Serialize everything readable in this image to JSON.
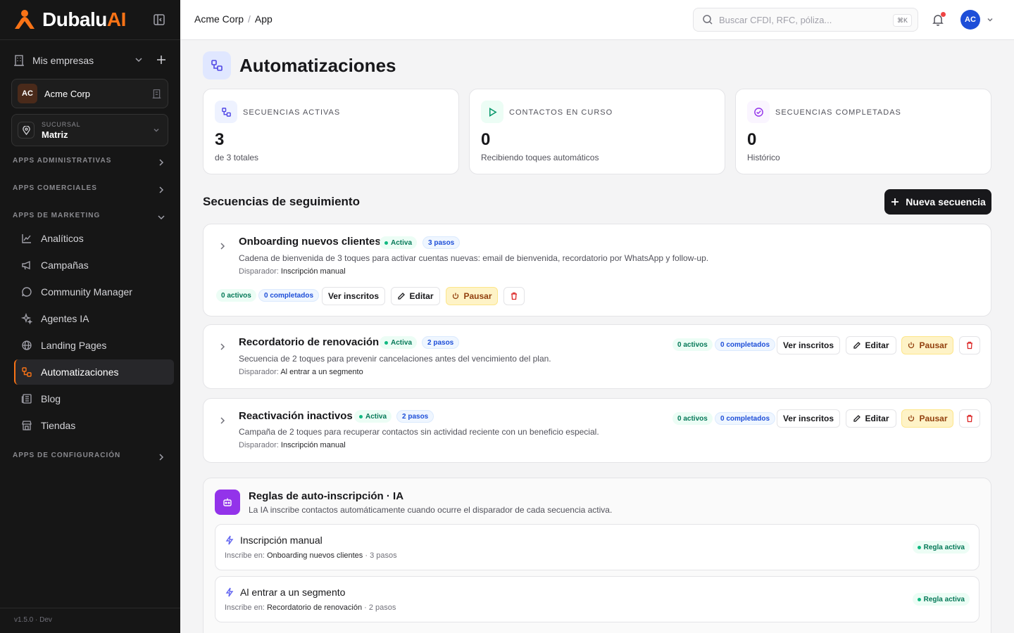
{
  "brand": {
    "name_main": "Dubalu",
    "name_accent": "AI"
  },
  "sidebar": {
    "mis_empresas": "Mis empresas",
    "company": {
      "initials": "AC",
      "name": "Acme Corp"
    },
    "branch": {
      "label": "SUCURSAL",
      "value": "Matriz"
    },
    "sections": {
      "admin": "APPS ADMINISTRATIVAS",
      "comercial": "APPS COMERCIALES",
      "marketing": "APPS DE MARKETING",
      "config": "APPS DE CONFIGURACIÓN"
    },
    "items": [
      {
        "label": "Analíticos",
        "icon": "chart-line-icon"
      },
      {
        "label": "Campañas",
        "icon": "megaphone-icon"
      },
      {
        "label": "Community Manager",
        "icon": "chat-bubble-icon"
      },
      {
        "label": "Agentes IA",
        "icon": "sparkles-icon"
      },
      {
        "label": "Landing Pages",
        "icon": "globe-icon"
      },
      {
        "label": "Automatizaciones",
        "icon": "workflow-icon",
        "active": true
      },
      {
        "label": "Blog",
        "icon": "newspaper-icon"
      },
      {
        "label": "Tiendas",
        "icon": "store-icon"
      }
    ],
    "version": "v1.5.0 · Dev"
  },
  "topbar": {
    "breadcrumb": [
      "Acme Corp",
      "App"
    ],
    "search_placeholder": "Buscar CFDI, RFC, póliza...",
    "shortcut": "⌘K",
    "avatar_initials": "AC"
  },
  "page": {
    "title": "Automatizaciones",
    "stats": [
      {
        "label": "SECUENCIAS ACTIVAS",
        "value": "3",
        "sub": "de 3 totales",
        "color": "#4f46e5"
      },
      {
        "label": "CONTACTOS EN CURSO",
        "value": "0",
        "sub": "Recibiendo toques automáticos",
        "color": "#059669"
      },
      {
        "label": "SECUENCIAS COMPLETADAS",
        "value": "0",
        "sub": "Histórico",
        "color": "#9333ea"
      }
    ],
    "section_title": "Secuencias de seguimiento",
    "new_button": "Nueva secuencia",
    "sequences": [
      {
        "name": "Onboarding nuevos clientes",
        "status": "Activa",
        "steps": "3 pasos",
        "description": "Cadena de bienvenida de 3 toques para activar cuentas nuevas: email de bienvenida, recordatorio por WhatsApp y follow-up.",
        "trigger_label": "Disparador:",
        "trigger": "Inscripción manual",
        "active_count": "0 activos",
        "completed_count": "0 completados",
        "view": "Ver inscritos",
        "edit": "Editar",
        "pause": "Pausar"
      },
      {
        "name": "Recordatorio de renovación",
        "status": "Activa",
        "steps": "2 pasos",
        "description": "Secuencia de 2 toques para prevenir cancelaciones antes del vencimiento del plan.",
        "trigger_label": "Disparador:",
        "trigger": "Al entrar a un segmento",
        "active_count": "0 activos",
        "completed_count": "0 completados",
        "view": "Ver inscritos",
        "edit": "Editar",
        "pause": "Pausar"
      },
      {
        "name": "Reactivación inactivos",
        "status": "Activa",
        "steps": "2 pasos",
        "description": "Campaña de 2 toques para recuperar contactos sin actividad reciente con un beneficio especial.",
        "trigger_label": "Disparador:",
        "trigger": "Inscripción manual",
        "active_count": "0 activos",
        "completed_count": "0 completados",
        "view": "Ver inscritos",
        "edit": "Editar",
        "pause": "Pausar"
      }
    ],
    "rules": {
      "title": "Reglas de auto-inscripción · IA",
      "subtitle": "La IA inscribe contactos automáticamente cuando ocurre el disparador de cada secuencia activa.",
      "items": [
        {
          "name": "Inscripción manual",
          "prefix": "Inscribe en:",
          "target": "Onboarding nuevos clientes",
          "steps": "· 3 pasos",
          "badge": "Regla activa"
        },
        {
          "name": "Al entrar a un segmento",
          "prefix": "Inscribe en:",
          "target": "Recordatorio de renovación",
          "steps": "· 2 pasos",
          "badge": "Regla activa"
        }
      ]
    }
  }
}
